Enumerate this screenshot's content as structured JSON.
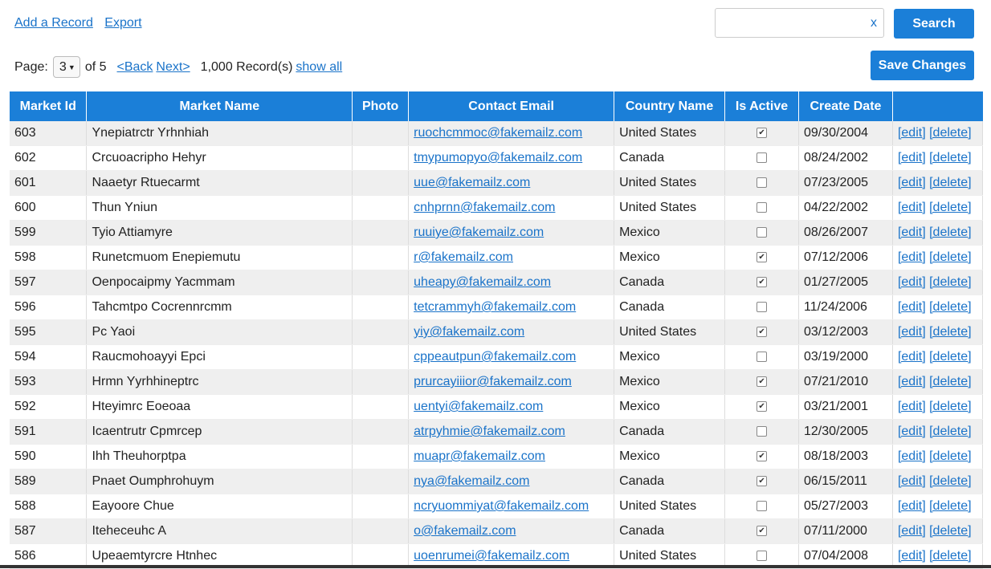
{
  "toolbar": {
    "add_record": "Add a Record",
    "export": "Export",
    "search_placeholder": "",
    "search_value": "",
    "clear": "x",
    "search_button": "Search",
    "save_button": "Save Changes"
  },
  "pager": {
    "page_label": "Page:",
    "current_page": "3",
    "of_text": "of 5",
    "back": "<Back",
    "next": "Next>",
    "record_count": "1,000 Record(s)",
    "show_all": "show all"
  },
  "table": {
    "columns": [
      "Market Id",
      "Market Name",
      "Photo",
      "Contact Email",
      "Country Name",
      "Is Active",
      "Create Date",
      ""
    ],
    "edit_label": "[edit]",
    "delete_label": "[delete]",
    "rows": [
      {
        "id": "603",
        "name": "Ynepiatrctr Yrhnhiah",
        "email": "ruochcmmoc@fakemailz.com",
        "country": "United States",
        "active": true,
        "date": "09/30/2004"
      },
      {
        "id": "602",
        "name": "Crcuoacripho Hehyr",
        "email": "tmypumopyo@fakemailz.com",
        "country": "Canada",
        "active": false,
        "date": "08/24/2002"
      },
      {
        "id": "601",
        "name": "Naaetyr Rtuecarmt",
        "email": "uue@fakemailz.com",
        "country": "United States",
        "active": false,
        "date": "07/23/2005"
      },
      {
        "id": "600",
        "name": "Thun Yniun",
        "email": "cnhprnn@fakemailz.com",
        "country": "United States",
        "active": false,
        "date": "04/22/2002"
      },
      {
        "id": "599",
        "name": "Tyio Attiamyre",
        "email": "ruuiye@fakemailz.com",
        "country": "Mexico",
        "active": false,
        "date": "08/26/2007"
      },
      {
        "id": "598",
        "name": "Runetcmuom Enepiemutu",
        "email": "r@fakemailz.com",
        "country": "Mexico",
        "active": true,
        "date": "07/12/2006"
      },
      {
        "id": "597",
        "name": "Oenpocaipmy Yacmmam",
        "email": "uheapy@fakemailz.com",
        "country": "Canada",
        "active": true,
        "date": "01/27/2005"
      },
      {
        "id": "596",
        "name": "Tahcmtpo Cocrennrcmm",
        "email": "tetcrammyh@fakemailz.com",
        "country": "Canada",
        "active": false,
        "date": "11/24/2006"
      },
      {
        "id": "595",
        "name": "Pc Yaoi",
        "email": "yiy@fakemailz.com",
        "country": "United States",
        "active": true,
        "date": "03/12/2003"
      },
      {
        "id": "594",
        "name": "Raucmohoayyi Epci",
        "email": "cppeautpun@fakemailz.com",
        "country": "Mexico",
        "active": false,
        "date": "03/19/2000"
      },
      {
        "id": "593",
        "name": "Hrmn Yyrhhineptrc",
        "email": "prurcayiiior@fakemailz.com",
        "country": "Mexico",
        "active": true,
        "date": "07/21/2010"
      },
      {
        "id": "592",
        "name": "Hteyimrc Eoeoaa",
        "email": "uentyi@fakemailz.com",
        "country": "Mexico",
        "active": true,
        "date": "03/21/2001"
      },
      {
        "id": "591",
        "name": "Icaentrutr Cpmrcep",
        "email": "atrpyhmie@fakemailz.com",
        "country": "Canada",
        "active": false,
        "date": "12/30/2005"
      },
      {
        "id": "590",
        "name": "Ihh Theuhorptpa",
        "email": "muapr@fakemailz.com",
        "country": "Mexico",
        "active": true,
        "date": "08/18/2003"
      },
      {
        "id": "589",
        "name": "Pnaet Oumphrohuym",
        "email": "nya@fakemailz.com",
        "country": "Canada",
        "active": true,
        "date": "06/15/2011"
      },
      {
        "id": "588",
        "name": "Eayoore Chue",
        "email": "ncryuommiyat@fakemailz.com",
        "country": "United States",
        "active": false,
        "date": "05/27/2003"
      },
      {
        "id": "587",
        "name": "Iteheceuhc A",
        "email": "o@fakemailz.com",
        "country": "Canada",
        "active": true,
        "date": "07/11/2000"
      },
      {
        "id": "586",
        "name": "Upeaemtyrcre Htnhec",
        "email": "uoenrumei@fakemailz.com",
        "country": "United States",
        "active": false,
        "date": "07/04/2008"
      }
    ]
  }
}
